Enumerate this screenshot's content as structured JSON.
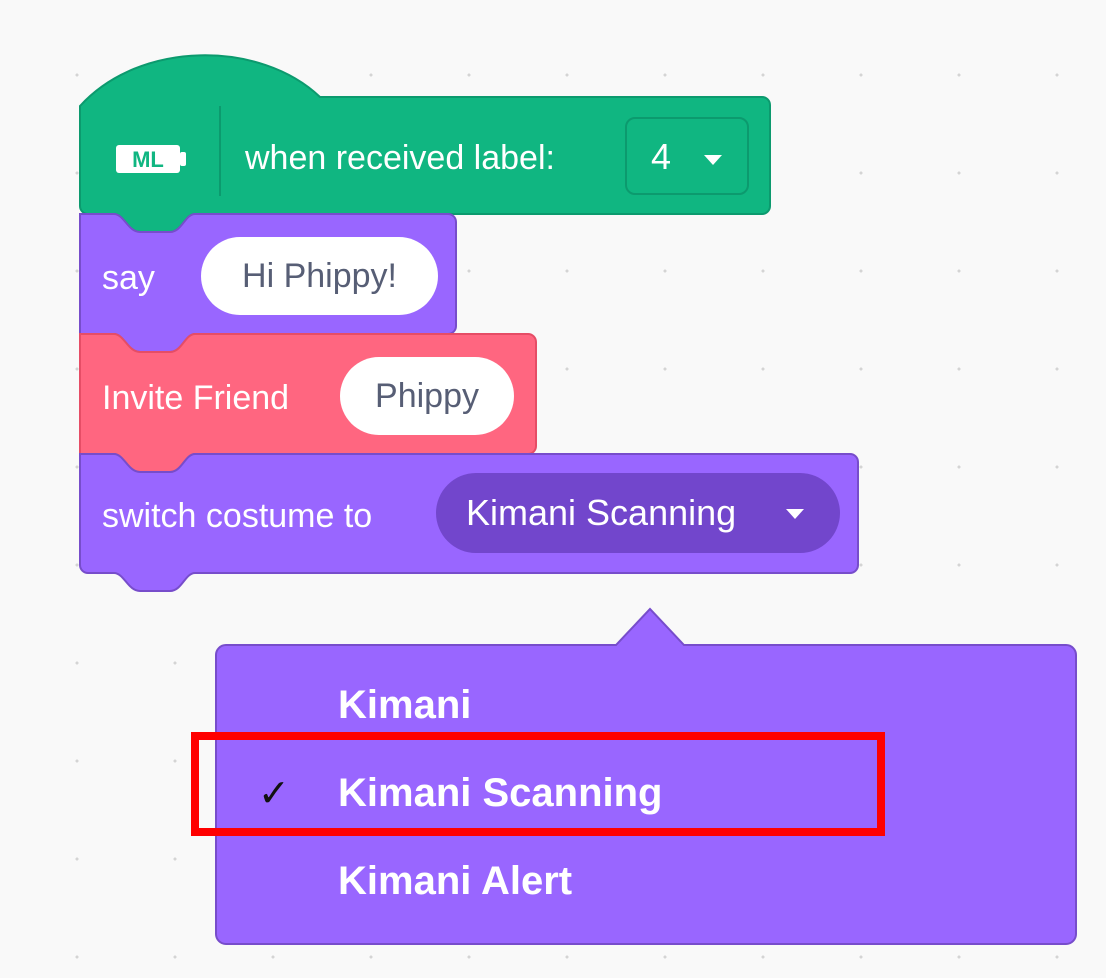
{
  "hat_block": {
    "icon_text": "ML",
    "label": "when received label:",
    "dropdown_value": "4"
  },
  "say_block": {
    "label": "say",
    "input_value": "Hi Phippy!"
  },
  "invite_block": {
    "label": "Invite Friend",
    "input_value": "Phippy"
  },
  "costume_block": {
    "label": "switch costume to",
    "selected_value": "Kimani Scanning"
  },
  "costume_menu": {
    "items": [
      {
        "label": "Kimani"
      },
      {
        "label": "Kimani Scanning",
        "check": "✓"
      },
      {
        "label": "Kimani Alert"
      }
    ]
  },
  "colors": {
    "workspace_bg": "#f9f9f9",
    "ml_block": "#10b681",
    "looks_block": "#9966ff",
    "friends_block": "#ff6680",
    "dropdown_menu": "#9966ff",
    "highlight_outline": "#ff0000"
  }
}
